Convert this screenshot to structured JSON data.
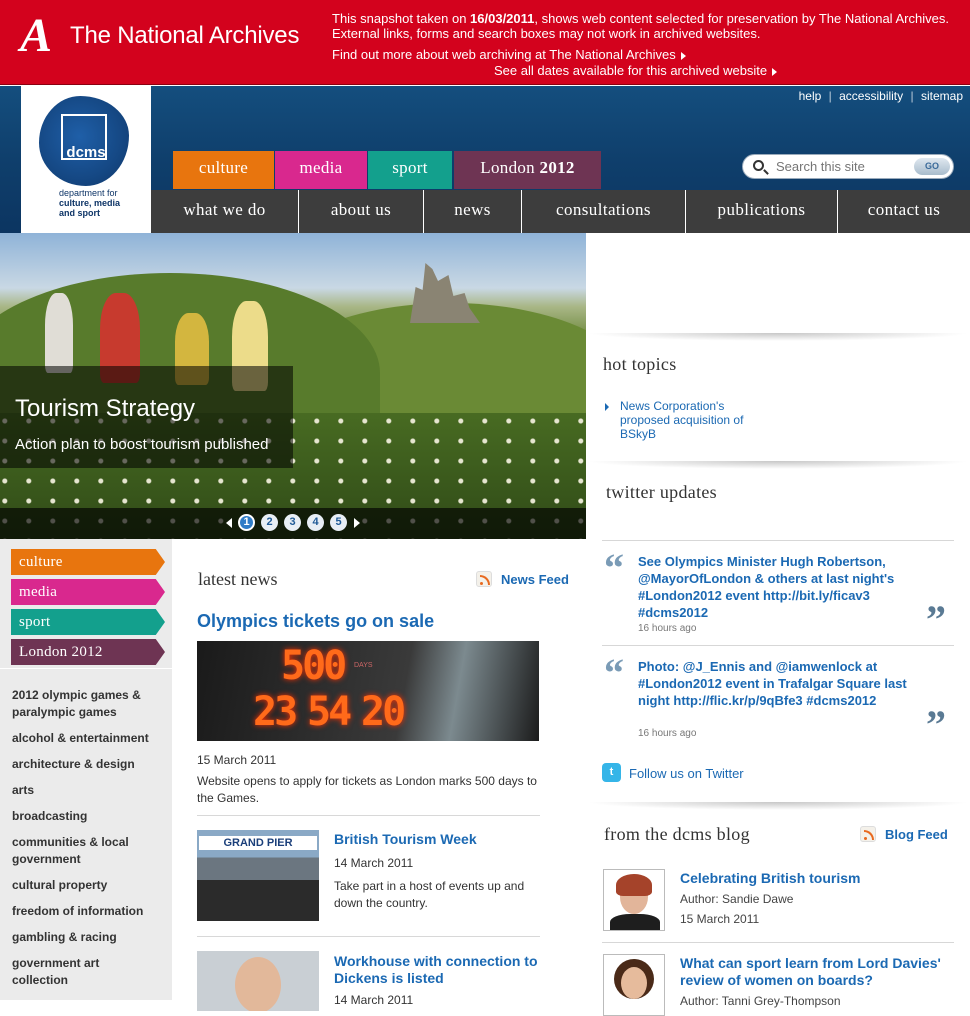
{
  "archive": {
    "logo_letter": "A",
    "logo_text": "The National Archives",
    "snapshot_pre": "This snapshot taken on ",
    "snapshot_date": "16/03/2011",
    "snapshot_post": ", shows web content selected for preservation by The National Archives. External links, forms and search boxes may not work in archived websites.",
    "find_out_link": "Find out more about web archiving at The National Archives",
    "dates_link": "See all dates available for this archived website"
  },
  "logo": {
    "abbr": "dcms",
    "line1": "department for",
    "line2": "culture, media",
    "line3": "and sport"
  },
  "utility": {
    "help": "help",
    "accessibility": "accessibility",
    "sitemap": "sitemap",
    "sep": "|"
  },
  "search": {
    "placeholder": "Search this site",
    "go_label": "GO"
  },
  "sector_tabs": [
    {
      "label": "culture",
      "color": "#e8750e"
    },
    {
      "label": "media",
      "color": "#d9288e"
    },
    {
      "label": "sport",
      "color": "#13a08d"
    },
    {
      "label_pre": "London ",
      "label_year": "2012",
      "color": "#6e3453"
    }
  ],
  "nav": [
    "what we do",
    "about us",
    "news",
    "consultations",
    "publications",
    "contact us"
  ],
  "hero": {
    "title": "Tourism Strategy",
    "subtitle": "Action plan to boost tourism published",
    "pages": [
      "1",
      "2",
      "3",
      "4",
      "5"
    ],
    "active_page": "1"
  },
  "hot_topics": {
    "heading": "hot topics",
    "items": [
      "News Corporation's proposed acquisition of BSkyB"
    ]
  },
  "twitter": {
    "heading": "twitter updates",
    "tweets": [
      {
        "text": "See Olympics Minister Hugh Robertson, @MayorOfLondon & others at last night's #London2012 event http://bit.ly/ficav3 #dcms2012",
        "time": "16 hours ago"
      },
      {
        "text": "Photo: @J_Ennis and @iamwenlock at #London2012 event in Trafalgar Square last night http://flic.kr/p/9qBfe3 #dcms2012",
        "time": "16 hours ago"
      }
    ],
    "follow": "Follow us on Twitter",
    "bird_glyph": "t"
  },
  "blog": {
    "heading": "from the dcms blog",
    "feed_label": "Blog Feed",
    "posts": [
      {
        "title": "Celebrating British tourism",
        "author": "Author: Sandie Dawe",
        "date": "15 March 2011"
      },
      {
        "title": "What can sport learn from Lord Davies' review of women on boards?",
        "author": "Author: Tanni Grey-Thompson"
      }
    ]
  },
  "left_tabs": [
    {
      "label": "culture",
      "color": "#e8750e"
    },
    {
      "label": "media",
      "color": "#d9288e"
    },
    {
      "label": "sport",
      "color": "#13a08d"
    },
    {
      "label": "London 2012",
      "color": "#6e3453"
    }
  ],
  "left_links": [
    "2012 olympic games & paralympic games",
    "alcohol & entertainment",
    "architecture & design",
    "arts",
    "broadcasting",
    "communities & local government",
    "cultural property",
    "freedom of information",
    "gambling & racing",
    "government art collection"
  ],
  "news": {
    "heading": "latest news",
    "feed_label": "News Feed",
    "lead": {
      "title": "Olympics tickets go on sale",
      "date": "15 March 2011",
      "desc": "Website opens to apply for tickets as London marks 500 days to the Games.",
      "counter_days": "500",
      "counter_days_label": "DAYS",
      "counter_h": "23",
      "counter_m": "54",
      "counter_s": "20"
    },
    "items": [
      {
        "title": "British Tourism Week",
        "date": "14 March 2011",
        "desc": "Take part in a host of events up and down the country.",
        "image_text": "GRAND PIER"
      },
      {
        "title": "Workhouse with connection to Dickens is listed",
        "date": "14 March 2011"
      }
    ]
  }
}
